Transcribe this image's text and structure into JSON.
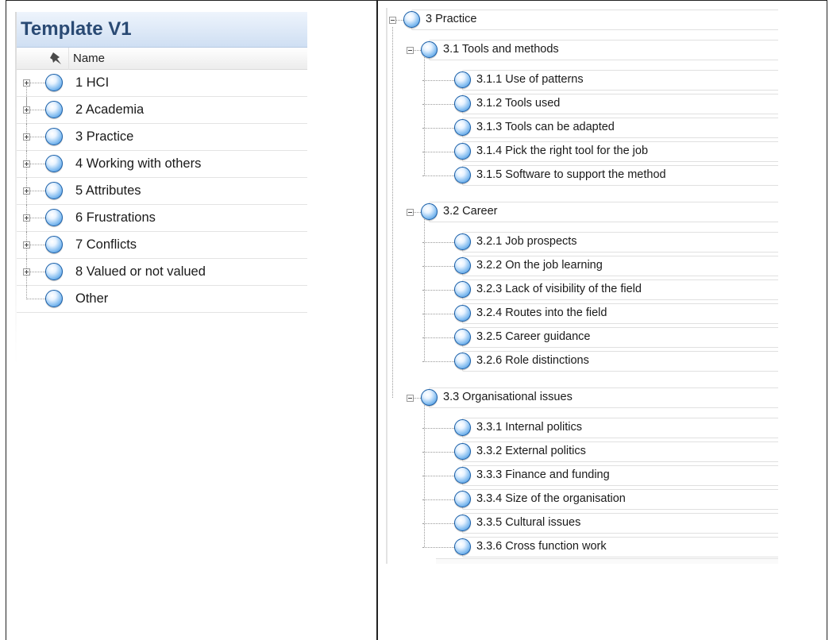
{
  "left": {
    "title": "Template V1",
    "column_header": "Name",
    "pin_icon": "pin-icon",
    "node_icon": "node-orb-icon",
    "items": [
      {
        "label": "1 HCI",
        "expandable": true
      },
      {
        "label": "2 Academia",
        "expandable": true
      },
      {
        "label": "3 Practice",
        "expandable": true
      },
      {
        "label": "4 Working with others",
        "expandable": true
      },
      {
        "label": "5 Attributes",
        "expandable": true
      },
      {
        "label": "6 Frustrations",
        "expandable": true
      },
      {
        "label": "7 Conflicts",
        "expandable": true
      },
      {
        "label": "8 Valued or not valued",
        "expandable": true
      },
      {
        "label": "Other",
        "expandable": false
      }
    ]
  },
  "right": {
    "root": {
      "label": "3 Practice",
      "expanded": true
    },
    "groups": [
      {
        "label": "3.1 Tools and methods",
        "children": [
          "3.1.1 Use of patterns",
          "3.1.2 Tools used",
          "3.1.3 Tools can be adapted",
          "3.1.4 Pick the right tool for the job",
          "3.1.5 Software to support the method"
        ]
      },
      {
        "label": "3.2 Career",
        "children": [
          "3.2.1 Job prospects",
          "3.2.2 On the job learning",
          "3.2.3 Lack of visibility of the field",
          "3.2.4 Routes into the field",
          "3.2.5 Career guidance",
          "3.2.6 Role distinctions"
        ]
      },
      {
        "label": "3.3 Organisational issues",
        "children": [
          "3.3.1 Internal politics",
          "3.3.2 External politics",
          "3.3.3 Finance and funding",
          "3.3.4 Size of the organisation",
          "3.3.5 Cultural issues",
          "3.3.6 Cross function work"
        ]
      }
    ]
  },
  "colors": {
    "header_text": "#2a4a74",
    "orb_edge": "#1a5fa8",
    "tree_lines": "#9a9a9a"
  }
}
